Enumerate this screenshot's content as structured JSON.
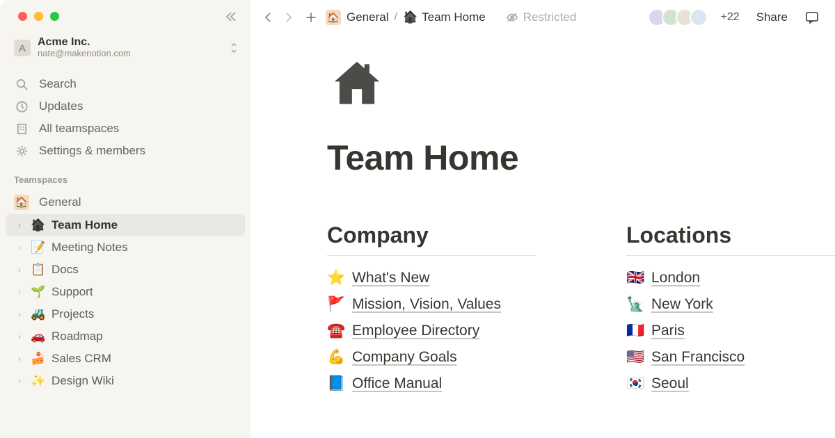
{
  "workspace": {
    "initial": "A",
    "name": "Acme Inc.",
    "email": "nate@makenotion.com"
  },
  "nav": {
    "search": "Search",
    "updates": "Updates",
    "teamspaces_all": "All teamspaces",
    "settings": "Settings & members"
  },
  "sections": {
    "teamspaces": "Teamspaces"
  },
  "teamspace": {
    "general": {
      "icon": "🏠",
      "name": "General"
    }
  },
  "pages": [
    {
      "icon": "🏠",
      "label": "Team Home",
      "selected": true,
      "icon_style": "dark"
    },
    {
      "icon": "📝",
      "label": "Meeting Notes"
    },
    {
      "icon": "📋",
      "label": "Docs"
    },
    {
      "icon": "🌱",
      "label": "Support"
    },
    {
      "icon": "🚜",
      "label": "Projects"
    },
    {
      "icon": "🚗",
      "label": "Roadmap"
    },
    {
      "icon": "🍰",
      "label": "Sales CRM"
    },
    {
      "icon": "✨",
      "label": "Design Wiki"
    }
  ],
  "breadcrumb": {
    "root_icon": "🏠",
    "root": "General",
    "page_icon": "🏠",
    "page": "Team Home"
  },
  "restricted": "Restricted",
  "more_count": "+22",
  "share": "Share",
  "title": "Team Home",
  "columns": {
    "company": {
      "heading": "Company",
      "items": [
        {
          "icon": "⭐",
          "label": "What's New"
        },
        {
          "icon": "🚩",
          "label": "Mission, Vision, Values"
        },
        {
          "icon": "☎️",
          "label": "Employee Directory"
        },
        {
          "icon": "💪",
          "label": "Company Goals"
        },
        {
          "icon": "📘",
          "label": "Office Manual"
        }
      ]
    },
    "locations": {
      "heading": "Locations",
      "items": [
        {
          "icon": "🇬🇧",
          "label": "London"
        },
        {
          "icon": "🗽",
          "label": "New York"
        },
        {
          "icon": "🇫🇷",
          "label": "Paris"
        },
        {
          "icon": "🇺🇸",
          "label": "San Francisco"
        },
        {
          "icon": "🇰🇷",
          "label": "Seoul"
        }
      ]
    }
  }
}
